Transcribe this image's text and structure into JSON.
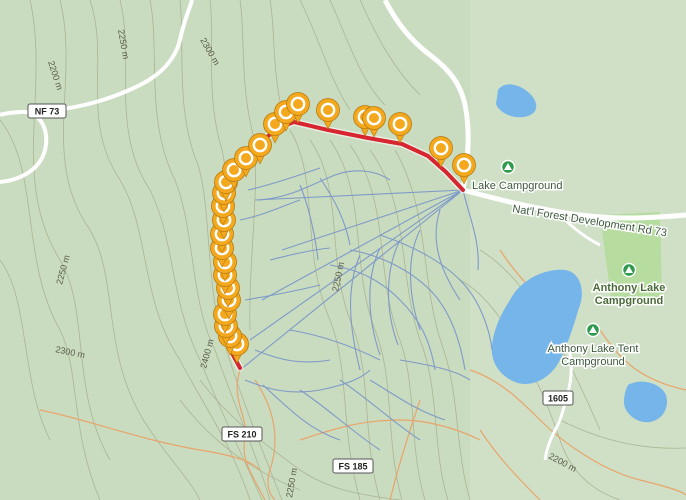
{
  "map": {
    "road_shields": [
      {
        "id": "nf73",
        "text": "NF 73"
      },
      {
        "id": "fs210",
        "text": "FS 210"
      },
      {
        "id": "fs185",
        "text": "FS 185"
      },
      {
        "id": "r1605",
        "text": "1605"
      }
    ],
    "place_labels": {
      "lake_campground": "Lake Campground",
      "road_73": "Nat'l Forest Development Rd 73",
      "anthony_lake_campground_line1": "Anthony Lake",
      "anthony_lake_campground_line2": "Campground",
      "anthony_lake_tent_line1": "Anthony Lake Tent",
      "anthony_lake_tent_line2": "Campground"
    },
    "contour_labels": {
      "c2200_left": "2200 m",
      "c2250_top": "2250 m",
      "c2300_top": "2300 m",
      "c2250_left": "2250 m",
      "c2300_left": "2300 m",
      "c2400": "2400 m",
      "c2250_mid": "2250 m",
      "c2200_right": "2200 m",
      "c2250_bottom": "2250 m"
    },
    "colors": {
      "terrain": "#c9dcc0",
      "track": "#d7262f",
      "marker_fill": "#f4a81d",
      "marker_ring": "#ffffff",
      "ski_lift": "#7b97c9",
      "water": "#76b5ea",
      "road": "#ffffff",
      "trail_orange": "#e9a46b",
      "campground_green": "#2f9a4c"
    },
    "icons": {
      "marker": "map-pin-icon",
      "campground": "campground-icon"
    }
  }
}
